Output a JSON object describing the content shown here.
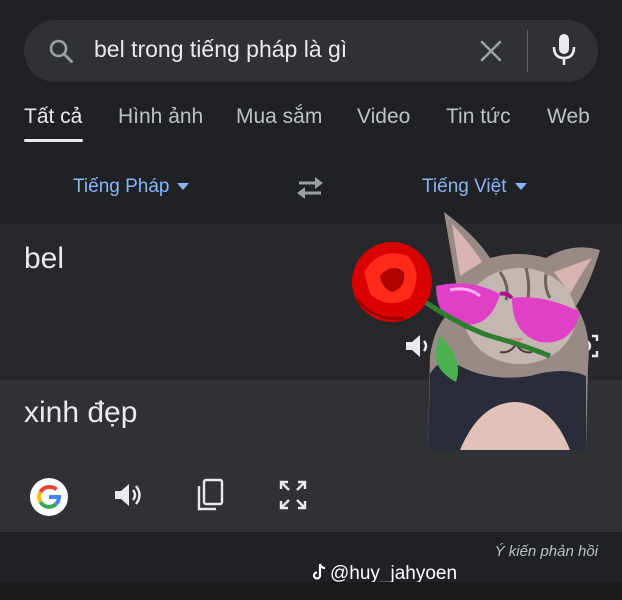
{
  "search": {
    "query": "bel trong tiếng pháp là gì"
  },
  "tabs": [
    "Tất cả",
    "Hình ảnh",
    "Mua sắm",
    "Video",
    "Tin tức",
    "Web"
  ],
  "translator": {
    "source_language": "Tiếng Pháp",
    "target_language": "Tiếng Việt",
    "source_text": "bel",
    "translated_text": "xinh đẹp"
  },
  "footer": {
    "feedback": "Ý kiến phản hồi"
  },
  "watermark": {
    "handle": "@huy_jahyoen"
  },
  "colors": {
    "background": "#202124",
    "panel": "#303134",
    "link": "#8ab4f8",
    "text": "#e8eaed"
  }
}
